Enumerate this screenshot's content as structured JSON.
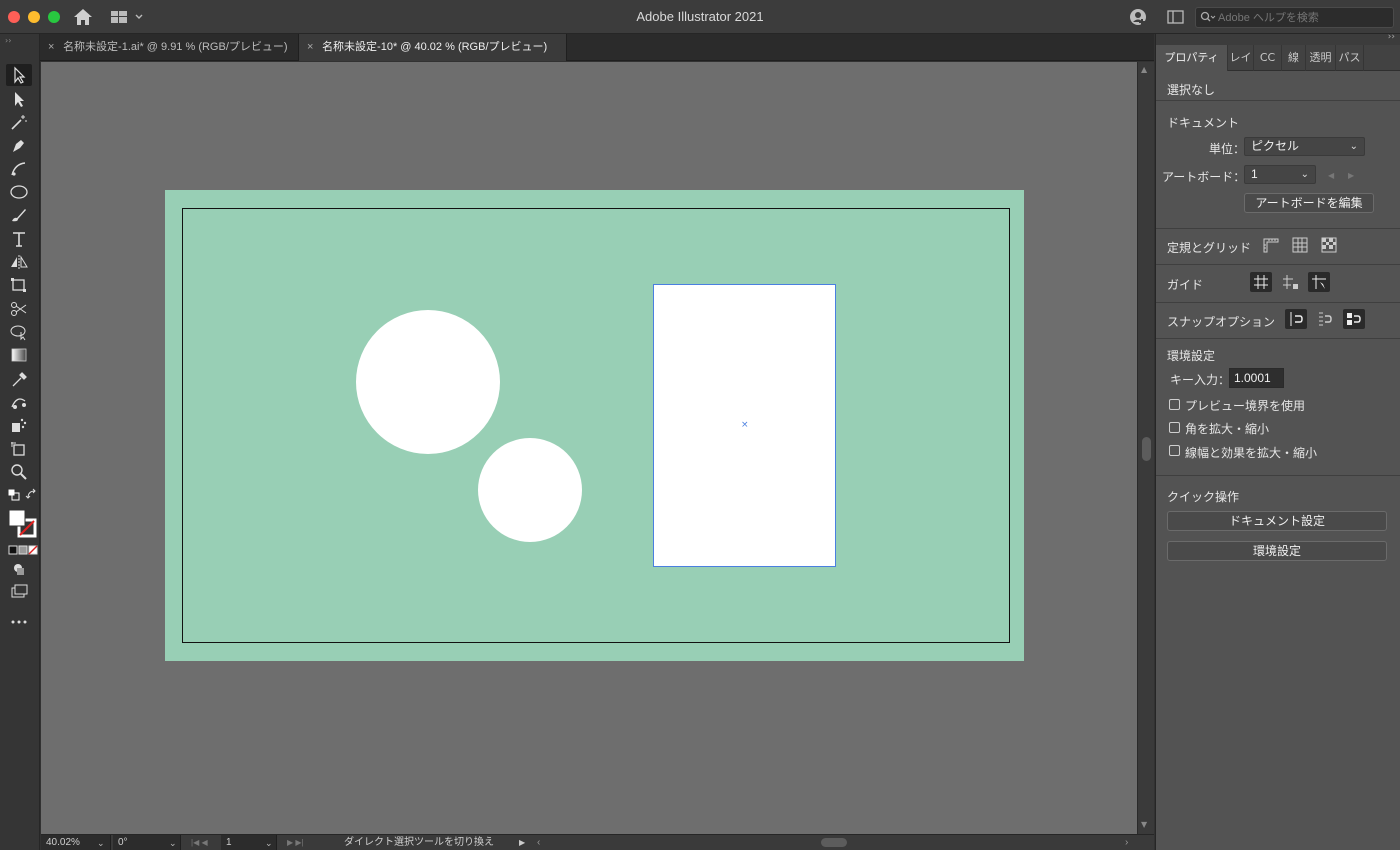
{
  "window": {
    "title": "Adobe Illustrator 2021"
  },
  "help_search": {
    "placeholder": "Adobe ヘルプを検索"
  },
  "tabs": [
    {
      "label": "名称未設定-1.ai* @ 9.91 % (RGB/プレビュー)",
      "close": "×"
    },
    {
      "label": "名称未設定-10* @ 40.02 % (RGB/プレビュー)",
      "close": "×"
    }
  ],
  "statusbar": {
    "zoom": "40.02%",
    "rotation": "0°",
    "artboard_number": "1",
    "status_text": "ダイレクト選択ツールを切り換え"
  },
  "properties_panel": {
    "tabs": [
      "プロパティ",
      "レイ",
      "CC",
      "線",
      "透明",
      "パス"
    ],
    "selection": "選択なし",
    "document": {
      "heading": "ドキュメント",
      "unit_label": "単位：",
      "unit_value": "ピクセル",
      "artboard_label": "アートボード：",
      "artboard_value": "1",
      "edit_artboards": "アートボードを編集"
    },
    "rulers_grid": "定規とグリッド",
    "guides": "ガイド",
    "snap_options": "スナップオプション",
    "preferences": {
      "heading": "環境設定",
      "key_input_label": "キー入力：",
      "key_input_value": "1.0001 px",
      "preview_bounds": "プレビュー境界を使用",
      "scale_corners": "角を拡大・縮小",
      "scale_strokes": "線幅と効果を拡大・縮小"
    },
    "quick_actions": {
      "heading": "クイック操作",
      "document_setup": "ドキュメント設定",
      "preferences": "環境設定"
    }
  },
  "colors": {
    "artwork_background": "#98cfb5",
    "canvas": "#6e6e6e",
    "selection": "#4a7fe0"
  }
}
